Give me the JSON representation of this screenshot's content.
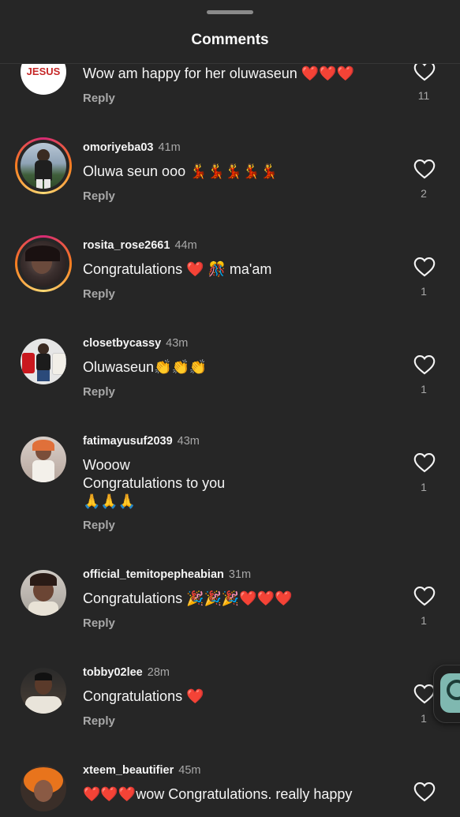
{
  "header": {
    "title": "Comments"
  },
  "reply_label": "Reply",
  "comments": [
    {
      "username": "",
      "time": "",
      "text": "Wow am happy for her oluwaseun ❤️❤️❤️",
      "avatar_text": "JESUS",
      "likes": "11",
      "has_story": false
    },
    {
      "username": "omoriyeba03",
      "time": "41m",
      "text": "Oluwa seun ooo 💃💃💃💃💃",
      "likes": "2",
      "has_story": true
    },
    {
      "username": "rosita_rose2661",
      "time": "44m",
      "text": "Congratulations ❤️ 🎊 ma'am",
      "likes": "1",
      "has_story": true
    },
    {
      "username": "closetbycassy",
      "time": "43m",
      "text": "Oluwaseun👏👏👏",
      "likes": "1",
      "has_story": false
    },
    {
      "username": "fatimayusuf2039",
      "time": "43m",
      "text": "Wooow\nCongratulations to you\n🙏🙏🙏",
      "likes": "1",
      "has_story": false
    },
    {
      "username": "official_temitopepheabian",
      "time": "31m",
      "text": "Congratulations 🎉🎉🎉❤️❤️❤️",
      "likes": "1",
      "has_story": false
    },
    {
      "username": "tobby02lee",
      "time": "28m",
      "text": "Congratulations ❤️",
      "likes": "1",
      "has_story": false
    },
    {
      "username": "xteem_beautifier",
      "time": "45m",
      "text": "❤️❤️❤️wow Congratulations. really happy",
      "likes": "",
      "has_story": false
    }
  ],
  "colors": {
    "background": "#262626",
    "secondary_text": "#a8a8a8",
    "story_ring": [
      "#d62976",
      "#fa7e1e",
      "#feda75"
    ]
  }
}
